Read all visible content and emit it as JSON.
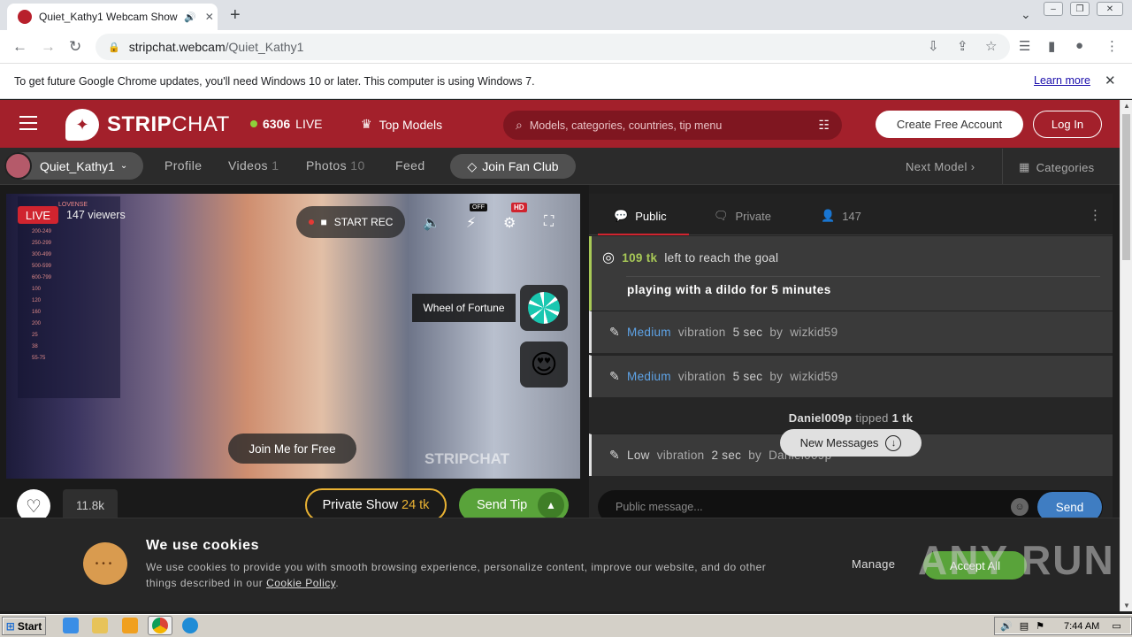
{
  "browser": {
    "tab_title": "Quiet_Kathy1 Webcam Show | …",
    "url_host": "stripchat.webcam",
    "url_path": "/Quiet_Kathy1",
    "infobar_text": "To get future Google Chrome updates, you'll need Windows 10 or later. This computer is using Windows 7.",
    "learn_more": "Learn more"
  },
  "header": {
    "logo_bold": "STRIP",
    "logo_light": "CHAT",
    "live_count": "6306",
    "live_label": "LIVE",
    "top_models": "Top Models",
    "search_placeholder": "Models, categories, countries, tip menu",
    "create_account": "Create Free Account",
    "login": "Log In"
  },
  "model_bar": {
    "model_name": "Quiet_Kathy1",
    "profile": "Profile",
    "videos": "Videos",
    "videos_count": "1",
    "photos": "Photos",
    "photos_count": "10",
    "feed": "Feed",
    "fan_club": "Join Fan Club",
    "next_model": "Next Model",
    "categories": "Categories"
  },
  "video": {
    "live_badge": "LIVE",
    "viewers": "147 viewers",
    "start_rec": "START REC",
    "flash_badge": "OFF",
    "hd_badge": "HD",
    "wheel_label": "Wheel of Fortune",
    "join_free": "Join Me for Free",
    "watermark": "STRIPCHAT",
    "lovense_title": "LOVENSE",
    "lovense_rows": [
      "150-199",
      "200-249",
      "250-299",
      "300-499",
      "500-599",
      "600-799",
      "100",
      "120",
      "160",
      "200",
      "25",
      "38",
      "55-75"
    ],
    "likes": "11.8k",
    "private_show": "Private Show",
    "private_price": "24 tk",
    "send_tip": "Send Tip"
  },
  "chat": {
    "tab_public": "Public",
    "tab_private": "Private",
    "tab_users": "147",
    "goal_amount": "109 tk",
    "goal_text": "left to reach the goal",
    "goal_title": "playing with a dildo for 5 minutes",
    "messages": [
      {
        "level": "Medium",
        "action": "vibration",
        "duration": "5 sec",
        "by": "by",
        "user": "wizkid59"
      },
      {
        "level": "Medium",
        "action": "vibration",
        "duration": "5 sec",
        "by": "by",
        "user": "wizkid59"
      },
      {
        "level": "Low",
        "action": "vibration",
        "duration": "2 sec",
        "by": "by",
        "user": "Daniel009p"
      }
    ],
    "tip_user": "Daniel009p",
    "tip_text": "tipped",
    "tip_amount": "1 tk",
    "new_messages": "New Messages",
    "input_placeholder": "Public message...",
    "send": "Send"
  },
  "cookies": {
    "title": "We use cookies",
    "text": "We use cookies to provide you with smooth browsing experience, personalize content, improve our website, and do other things described in our",
    "policy_link": "Cookie Policy",
    "manage": "Manage",
    "accept": "Accept All"
  },
  "watermark": {
    "text": "ANY RUN"
  },
  "taskbar": {
    "start": "Start",
    "clock": "7:44 AM"
  },
  "colors": {
    "brand": "#a3202b",
    "goal_green": "#a8c957",
    "tip_green": "#59a33a",
    "level_blue": "#5ea3e6"
  }
}
